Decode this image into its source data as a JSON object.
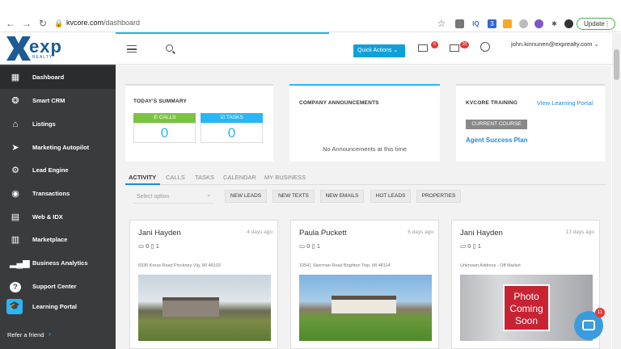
{
  "browser": {
    "url_host": "kvcore.com",
    "url_path": "/dashboard",
    "update_label": "Update",
    "ext_badge": "3"
  },
  "header": {
    "logo_text": "exp",
    "logo_sub": "REALTY",
    "quick_actions": "Quick Actions",
    "mail_badge": "0",
    "tasks_badge": "20",
    "user_email": "john.kinnunen@exprealty.com"
  },
  "sidebar": {
    "items": [
      {
        "label": "Dashboard",
        "icon": "dashboard-icon"
      },
      {
        "label": "Smart CRM",
        "icon": "crm-icon"
      },
      {
        "label": "Listings",
        "icon": "home-icon"
      },
      {
        "label": "Marketing Autopilot",
        "icon": "paper-plane-icon"
      },
      {
        "label": "Lead Engine",
        "icon": "lead-engine-icon"
      },
      {
        "label": "Transactions",
        "icon": "transactions-icon"
      },
      {
        "label": "Web & IDX",
        "icon": "web-idx-icon"
      },
      {
        "label": "Marketplace",
        "icon": "marketplace-icon"
      },
      {
        "label": "Business Analytics",
        "icon": "analytics-icon"
      },
      {
        "label": "Support Center",
        "icon": "help-icon"
      },
      {
        "label": "Learning Portal",
        "icon": "learning-icon"
      }
    ],
    "refer": "Refer a friend"
  },
  "summary": {
    "title": "TODAY'S SUMMARY",
    "calls_label": "CALLS",
    "tasks_label": "TASKS",
    "calls_value": "0",
    "tasks_value": "0"
  },
  "announcements": {
    "title": "COMPANY ANNOUNCEMENTS",
    "empty": "No Announcements at this time"
  },
  "training": {
    "title": "KVCORE TRAINING",
    "link": "View Learning Portal",
    "current_label": "CURRENT COURSE",
    "course": "Agent Success Plan"
  },
  "activity": {
    "tabs": [
      "ACTIVITY",
      "CALLS",
      "TASKS",
      "CALENDAR",
      "MY BUSINESS"
    ],
    "select_placeholder": "Select option",
    "filters": [
      "NEW LEADS",
      "NEW TEXTS",
      "NEW EMAILS",
      "HOT LEADS",
      "PROPERTIES"
    ]
  },
  "leads": [
    {
      "name": "Jani Hayden",
      "time": "4 days ago",
      "desktop": "0",
      "mobile": "1",
      "address": "5936 Kress Road Pinckney Vlg, MI 48103"
    },
    {
      "name": "Paula Puckett",
      "time": "6 days ago",
      "desktop": "0",
      "mobile": "1",
      "address": "10541 Skerman Road Brighton Twp, MI 48114"
    },
    {
      "name": "Jani Hayden",
      "time": "13 days ago",
      "desktop": "0",
      "mobile": "1",
      "address": "Unknown Address - Off Market"
    }
  ],
  "photo_placeholder": "Photo Coming Soon",
  "chat_badge": "11"
}
